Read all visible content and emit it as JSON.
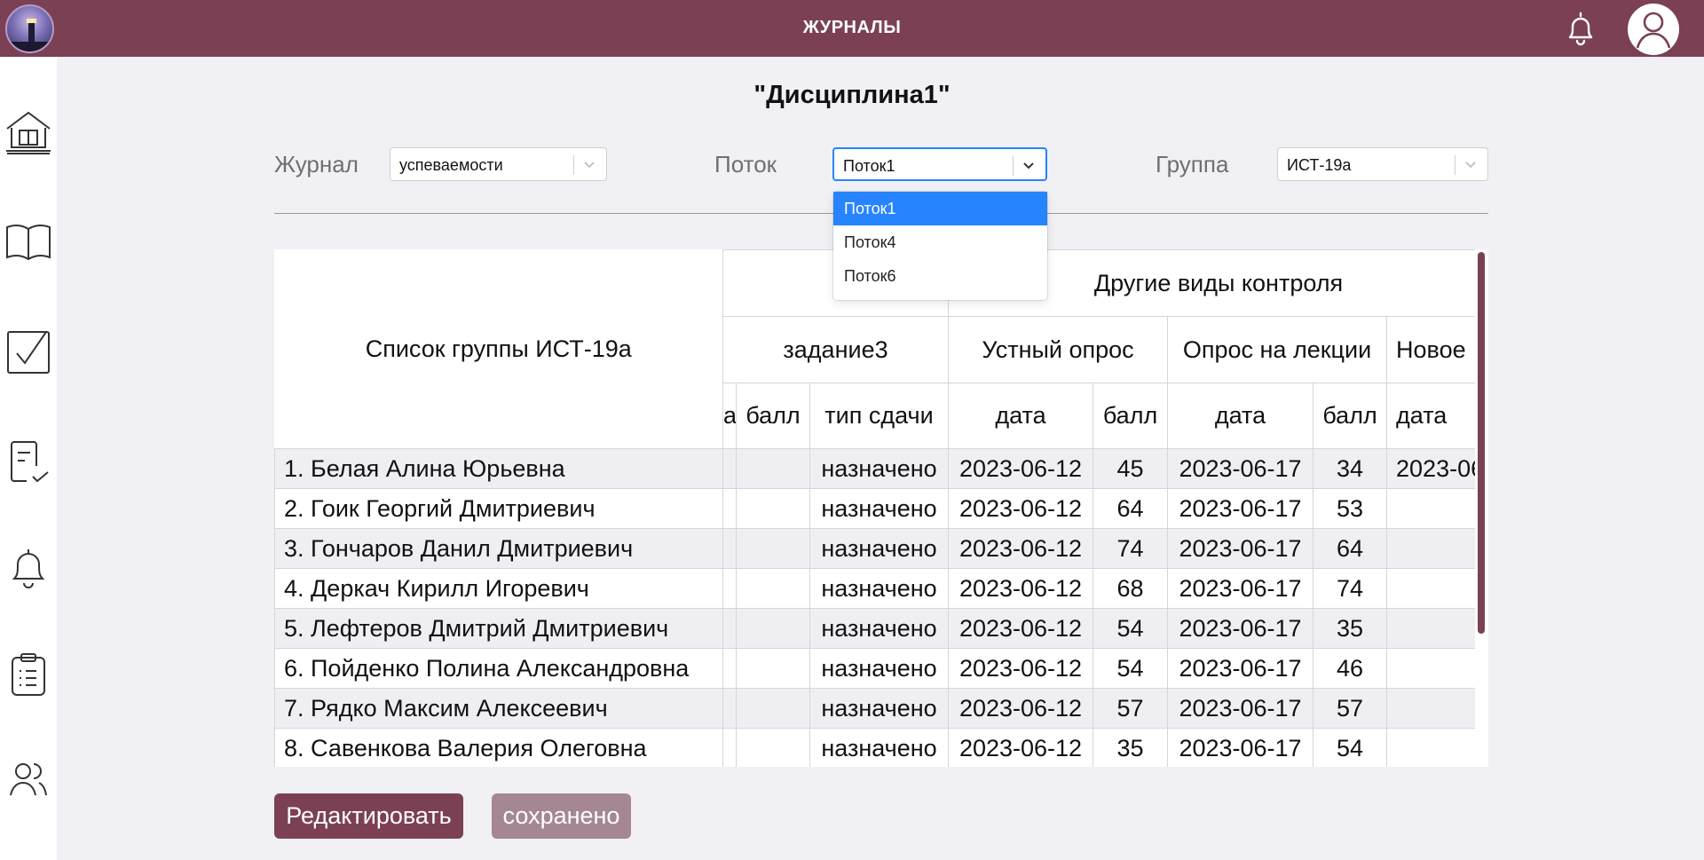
{
  "app": {
    "title": "ЖУРНАЛЫ"
  },
  "header": {
    "logo_icon": "lighthouse-logo",
    "bell_icon": "bell-icon",
    "avatar_icon": "user-avatar-icon"
  },
  "sidebar": {
    "items": [
      {
        "icon": "home-icon"
      },
      {
        "icon": "book-icon"
      },
      {
        "icon": "checkbox-icon"
      },
      {
        "icon": "document-check-icon"
      },
      {
        "icon": "bell-icon"
      },
      {
        "icon": "clipboard-list-icon"
      },
      {
        "icon": "users-icon"
      }
    ]
  },
  "page": {
    "title": "\"Дисциплина1\""
  },
  "filters": {
    "journal": {
      "label": "Журнал",
      "value": "успеваемости"
    },
    "stream": {
      "label": "Поток",
      "value": "Поток1",
      "options": [
        "Поток1",
        "Поток4",
        "Поток6"
      ]
    },
    "group": {
      "label": "Группа",
      "value": "ИСТ-19а"
    }
  },
  "table": {
    "group_header": "Список группы ИСТ-19а",
    "other_controls": "Другие виды контроля",
    "columns_row2": [
      "задание3",
      "Устный опрос",
      "Опрос на лекции",
      "Новое"
    ],
    "columns_row3": [
      "а",
      "балл",
      "тип сдачи",
      "дата",
      "балл",
      "дата",
      "балл",
      "дата"
    ],
    "rows": [
      {
        "name": "1. Белая Алина Юрьевна",
        "type": "назначено",
        "date1": "2023-06-12",
        "score1": "45",
        "date2": "2023-06-17",
        "score2": "34",
        "date3": "2023-06"
      },
      {
        "name": "2. Гоик Георгий Дмитриевич",
        "type": "назначено",
        "date1": "2023-06-12",
        "score1": "64",
        "date2": "2023-06-17",
        "score2": "53",
        "date3": ""
      },
      {
        "name": "3. Гончаров Данил Дмитриевич",
        "type": "назначено",
        "date1": "2023-06-12",
        "score1": "74",
        "date2": "2023-06-17",
        "score2": "64",
        "date3": ""
      },
      {
        "name": "4. Деркач Кирилл Игоревич",
        "type": "назначено",
        "date1": "2023-06-12",
        "score1": "68",
        "date2": "2023-06-17",
        "score2": "74",
        "date3": ""
      },
      {
        "name": "5. Лефтеров Дмитрий Дмитриевич",
        "type": "назначено",
        "date1": "2023-06-12",
        "score1": "54",
        "date2": "2023-06-17",
        "score2": "35",
        "date3": ""
      },
      {
        "name": "6. Пойденко Полина Александровна",
        "type": "назначено",
        "date1": "2023-06-12",
        "score1": "54",
        "date2": "2023-06-17",
        "score2": "46",
        "date3": ""
      },
      {
        "name": "7. Рядко Максим Алексеевич",
        "type": "назначено",
        "date1": "2023-06-12",
        "score1": "57",
        "date2": "2023-06-17",
        "score2": "57",
        "date3": ""
      },
      {
        "name": "8. Савенкова Валерия Олеговна",
        "type": "назначено",
        "date1": "2023-06-12",
        "score1": "35",
        "date2": "2023-06-17",
        "score2": "54",
        "date3": ""
      }
    ]
  },
  "buttons": {
    "edit": "Редактировать",
    "saved": "сохранено"
  },
  "colors": {
    "brand": "#7b4054",
    "focus": "#2684ff",
    "saved_button": "#a48793"
  }
}
